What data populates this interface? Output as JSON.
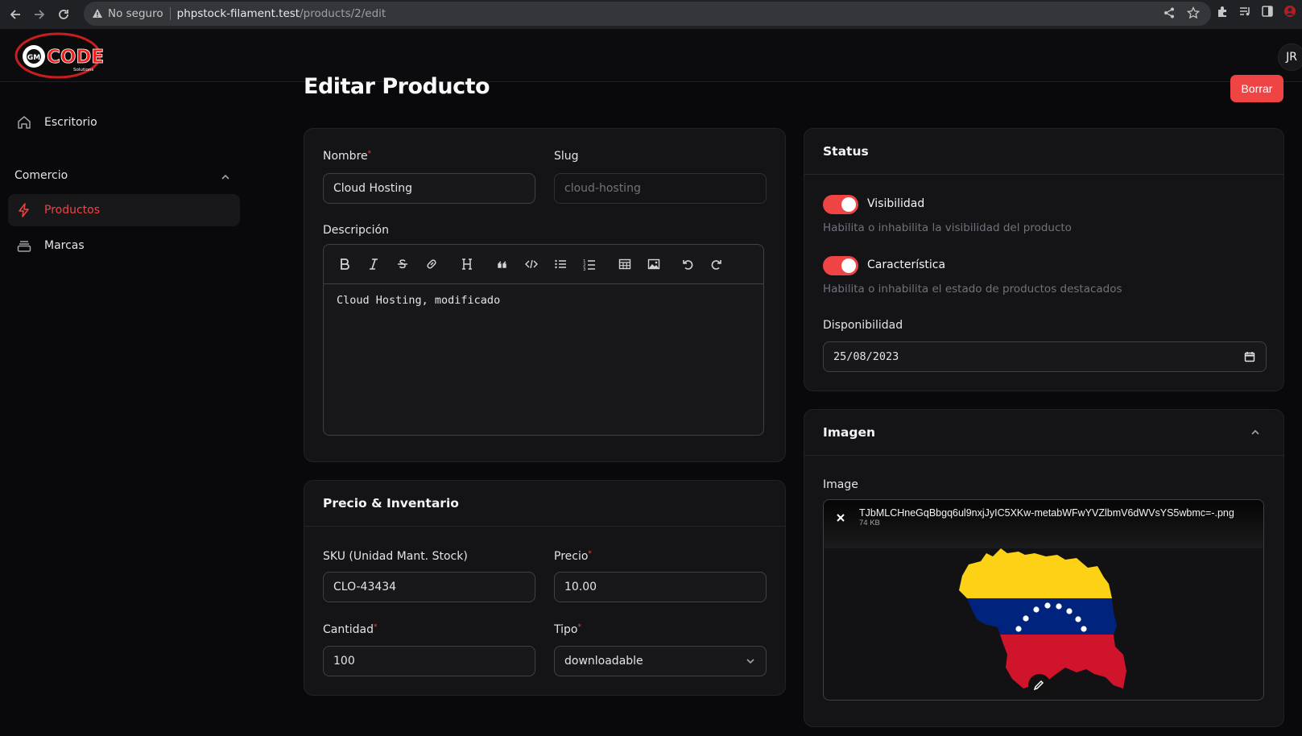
{
  "browser": {
    "security_label": "No seguro",
    "url_host": "phpstock-filament.test",
    "url_path": "/products/2/edit"
  },
  "topbar": {
    "avatar_initials": "JR"
  },
  "sidebar": {
    "items": [
      {
        "label": "Escritorio",
        "icon": "home-icon"
      },
      {
        "label": "Productos",
        "icon": "bolt-icon",
        "active": true
      },
      {
        "label": "Marcas",
        "icon": "stack-icon"
      }
    ],
    "group_label": "Comercio"
  },
  "page": {
    "title": "Editar Producto",
    "delete_label": "Borrar"
  },
  "product_form": {
    "name_label": "Nombre",
    "name_value": "Cloud Hosting",
    "slug_label": "Slug",
    "slug_value": "cloud-hosting",
    "description_label": "Descripción",
    "description_value": "Cloud Hosting, modificado"
  },
  "pricing": {
    "title": "Precio & Inventario",
    "sku_label": "SKU (Unidad Mant. Stock)",
    "sku_value": "CLO-43434",
    "price_label": "Precio",
    "price_value": "10.00",
    "quantity_label": "Cantidad",
    "quantity_value": "100",
    "type_label": "Tipo",
    "type_value": "downloadable"
  },
  "status": {
    "title": "Status",
    "visibility_label": "Visibilidad",
    "visibility_hint": "Habilita o inhabilita la visibilidad del producto",
    "featured_label": "Característica",
    "featured_hint": "Habilita o inhabilita el estado de productos destacados",
    "availability_label": "Disponibilidad",
    "availability_value": "25/08/2023"
  },
  "image_section": {
    "title": "Imagen",
    "field_label": "Image",
    "file_name": "TJbMLCHneGqBbgq6ul9nxjJyIC5XKw-metabWFwYVZlbmV6dWVsYS5wbmc=-.png",
    "file_size": "74 KB"
  },
  "colors": {
    "accent": "#ef4444",
    "background": "#09090b",
    "card": "#141417"
  }
}
